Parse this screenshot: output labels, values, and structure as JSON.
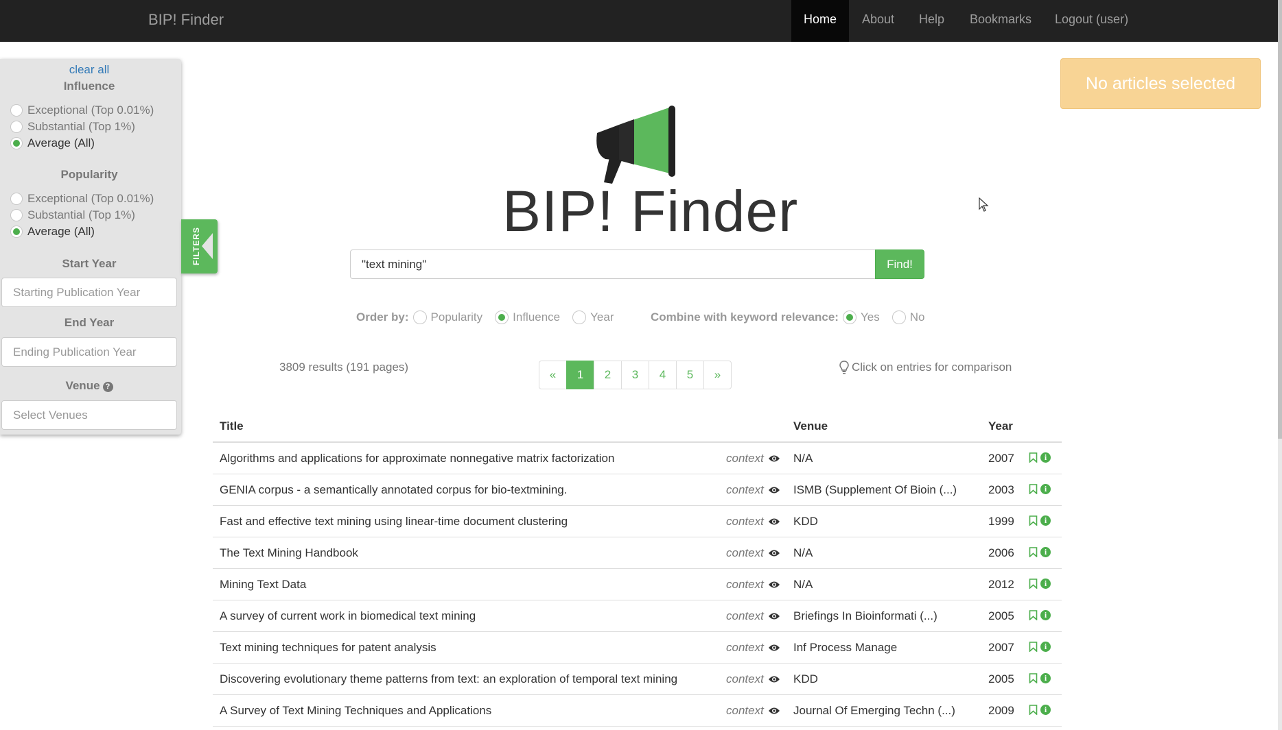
{
  "navbar": {
    "brand": "BIP! Finder",
    "items": [
      {
        "label": "Home"
      },
      {
        "label": "About"
      },
      {
        "label": "Help"
      },
      {
        "label": "Bookmarks"
      },
      {
        "label": "Logout (user)"
      }
    ]
  },
  "filters": {
    "clear_all": "clear all",
    "influence": {
      "heading": "Influence",
      "options": [
        "Exceptional (Top 0.01%)",
        "Substantial (Top 1%)",
        "Average (All)"
      ],
      "selected": "Average (All)"
    },
    "popularity": {
      "heading": "Popularity",
      "options": [
        "Exceptional (Top 0.01%)",
        "Substantial (Top 1%)",
        "Average (All)"
      ],
      "selected": "Average (All)"
    },
    "start_year": {
      "heading": "Start Year",
      "placeholder": "Starting Publication Year"
    },
    "end_year": {
      "heading": "End Year",
      "placeholder": "Ending Publication Year"
    },
    "venue": {
      "heading": "Venue",
      "help_icon": "question-circle-icon",
      "placeholder": "Select Venues"
    },
    "tab_label": "FILTERS"
  },
  "selection": {
    "label": "No articles selected"
  },
  "hero": {
    "title": "BIP! Finder",
    "logo_icon": "megaphone-icon"
  },
  "search": {
    "value": "\"text mining\"",
    "button_label": "Find!"
  },
  "order_by": {
    "label": "Order by:",
    "options": [
      "Popularity",
      "Influence",
      "Year"
    ],
    "selected": "Influence"
  },
  "keyword_relevance": {
    "label": "Combine with keyword relevance:",
    "options": [
      "Yes",
      "No"
    ],
    "selected": "Yes"
  },
  "results": {
    "count_text": "3809 results (191 pages)",
    "compare_hint": "Click on entries for comparison"
  },
  "pagination": {
    "prev": "«",
    "pages": [
      "1",
      "2",
      "3",
      "4",
      "5"
    ],
    "current": "1",
    "next": "»"
  },
  "table": {
    "headers": {
      "title": "Title",
      "venue": "Venue",
      "year": "Year"
    },
    "context_label": "context",
    "rows": [
      {
        "title": "Algorithms and applications for approximate nonnegative matrix factorization",
        "venue": "N/A",
        "year": "2007"
      },
      {
        "title": "GENIA corpus - a semantically annotated corpus for bio-textmining.",
        "venue": "ISMB (Supplement Of Bioin (...)",
        "year": "2003"
      },
      {
        "title": "Fast and effective text mining using linear-time document clustering",
        "venue": "KDD",
        "year": "1999"
      },
      {
        "title": "The Text Mining Handbook",
        "venue": "N/A",
        "year": "2006"
      },
      {
        "title": "Mining Text Data",
        "venue": "N/A",
        "year": "2012"
      },
      {
        "title": "A survey of current work in biomedical text mining",
        "venue": "Briefings In Bioinformati (...)",
        "year": "2005"
      },
      {
        "title": "Text mining techniques for patent analysis",
        "venue": "Inf Process Manage",
        "year": "2007"
      },
      {
        "title": "Discovering evolutionary theme patterns from text: an exploration of temporal text mining",
        "venue": "KDD",
        "year": "2005"
      },
      {
        "title": "A Survey of Text Mining Techniques and Applications",
        "venue": "Journal Of Emerging Techn (...)",
        "year": "2009"
      }
    ]
  },
  "colors": {
    "navbar_bg": "#222222",
    "accent_green": "#5cb85c",
    "link_blue": "#337ab7",
    "selection_orange": "#f8d495"
  }
}
